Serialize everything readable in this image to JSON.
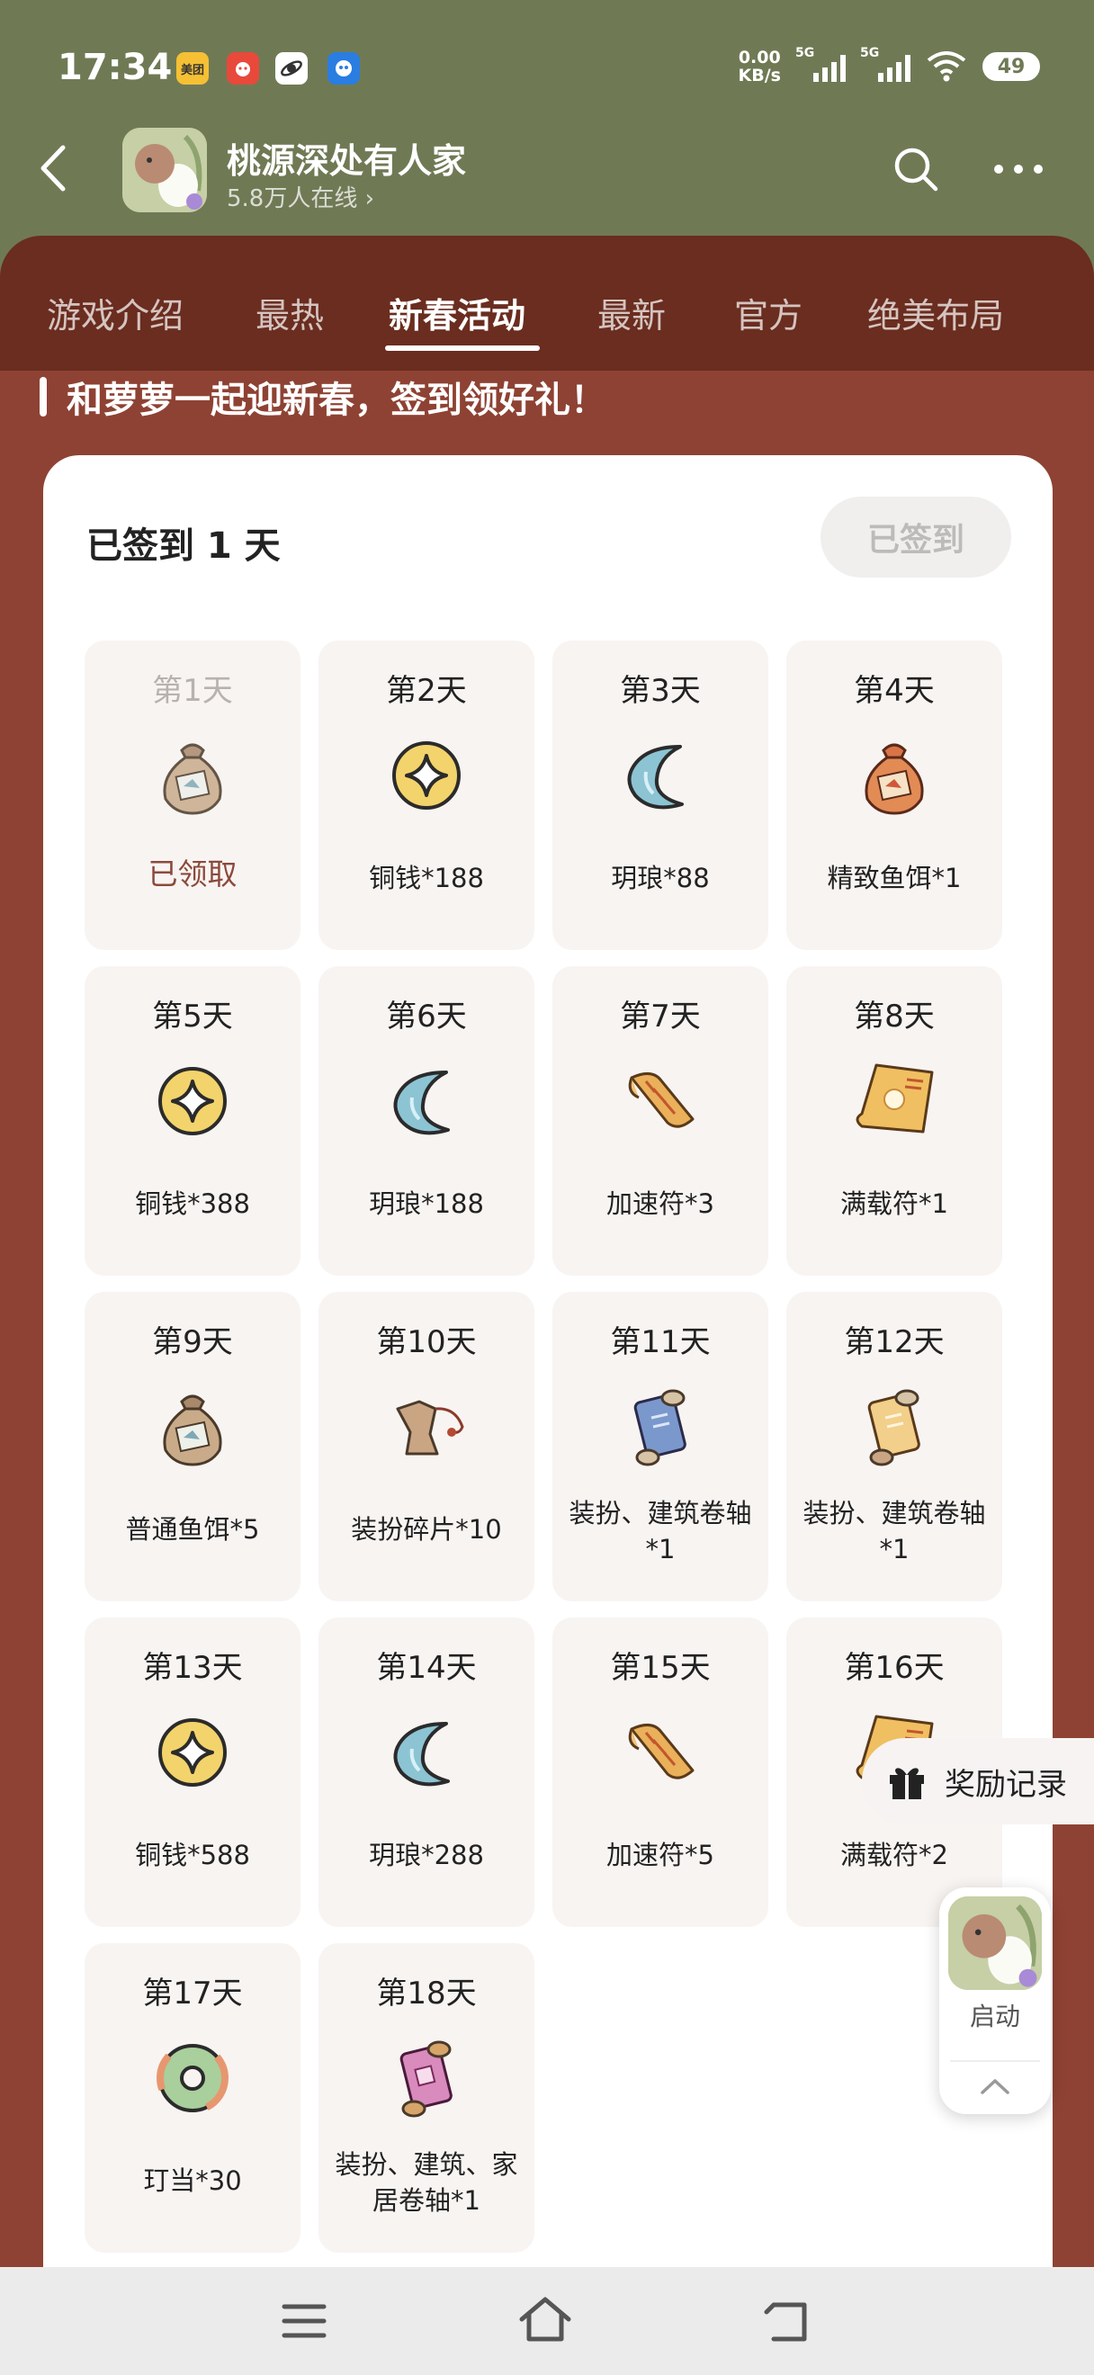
{
  "status_bar": {
    "time": "17:34",
    "app_badges": [
      {
        "label": "美团",
        "color": "#f5c034"
      },
      {
        "label": "",
        "color": "#e8493b"
      },
      {
        "label": "",
        "color": "#ffffff"
      },
      {
        "label": "",
        "color": "#2a7de1"
      }
    ],
    "net_speed_value": "0.00",
    "net_speed_unit": "KB/s",
    "signal1_label": "5G",
    "signal2_label": "5G",
    "battery": "49"
  },
  "header": {
    "game_title": "桃源深处有人家",
    "online_text": "5.8万人在线",
    "icons": [
      "back-arrow-icon",
      "search-icon",
      "more-icon"
    ]
  },
  "tabs": [
    {
      "label": "游戏介绍"
    },
    {
      "label": "最热"
    },
    {
      "label": "新春活动",
      "active": true
    },
    {
      "label": "最新"
    },
    {
      "label": "官方"
    },
    {
      "label": "绝美布局"
    }
  ],
  "banner_text": "和萝萝一起迎新春，签到领好礼！",
  "checkin": {
    "signed_days_text": "已签到 1 天",
    "signed_button": "已签到",
    "days": [
      {
        "title": "第1天",
        "label": "已领取",
        "icon": "fish-bait-bag-icon",
        "claimed": true
      },
      {
        "title": "第2天",
        "label": "铜钱*188",
        "icon": "coin-icon"
      },
      {
        "title": "第3天",
        "label": "玥琅*88",
        "icon": "moon-gem-icon"
      },
      {
        "title": "第4天",
        "label": "精致鱼饵*1",
        "icon": "fine-bait-bag-icon"
      },
      {
        "title": "第5天",
        "label": "铜钱*388",
        "icon": "coin-icon"
      },
      {
        "title": "第6天",
        "label": "玥琅*188",
        "icon": "moon-gem-icon"
      },
      {
        "title": "第7天",
        "label": "加速符*3",
        "icon": "speed-talisman-icon"
      },
      {
        "title": "第8天",
        "label": "满载符*1",
        "icon": "full-load-talisman-icon"
      },
      {
        "title": "第9天",
        "label": "普通鱼饵*5",
        "icon": "fish-bait-bag-icon"
      },
      {
        "title": "第10天",
        "label": "装扮碎片*10",
        "icon": "outfit-fragment-icon"
      },
      {
        "title": "第11天",
        "label": "装扮、建筑卷轴*1",
        "icon": "blue-scroll-icon"
      },
      {
        "title": "第12天",
        "label": "装扮、建筑卷轴*1",
        "icon": "yellow-scroll-icon"
      },
      {
        "title": "第13天",
        "label": "铜钱*588",
        "icon": "coin-icon"
      },
      {
        "title": "第14天",
        "label": "玥琅*288",
        "icon": "moon-gem-icon"
      },
      {
        "title": "第15天",
        "label": "加速符*5",
        "icon": "speed-talisman-icon"
      },
      {
        "title": "第16天",
        "label": "满载符*2",
        "icon": "full-load-talisman-icon"
      },
      {
        "title": "第17天",
        "label": "玎当*30",
        "icon": "jade-ring-icon"
      },
      {
        "title": "第18天",
        "label": "装扮、建筑、家居卷轴*1",
        "icon": "pink-scroll-icon"
      }
    ]
  },
  "reward_record": "奖励记录",
  "launch": {
    "label": "启动"
  },
  "colors": {
    "header_bg": "#6f7a55",
    "tabs_bg": "#6a2d1f",
    "page_bg": "#8e4233",
    "card_bg": "#ffffff",
    "day_bg": "#f8f4f2",
    "claimed_text": "#8b4a3c"
  }
}
